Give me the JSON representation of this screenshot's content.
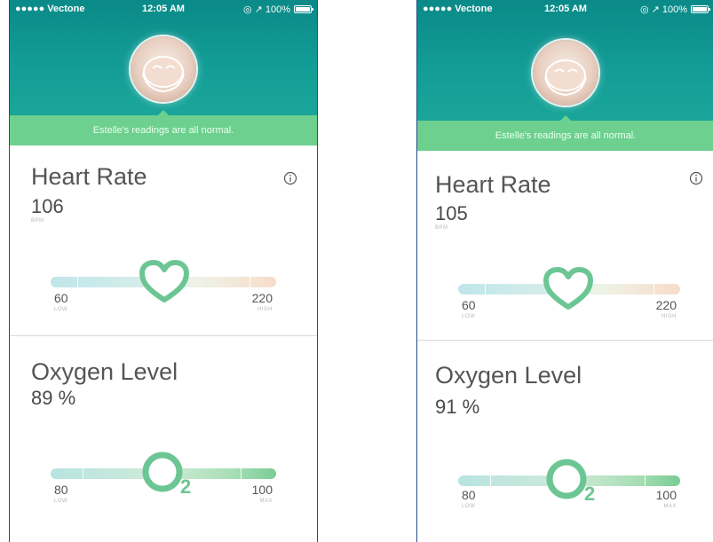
{
  "screens": [
    {
      "status": {
        "carrier": "●●●●● Vectone",
        "time": "12:05 AM",
        "right": "◎ ↗ 100%"
      },
      "banner": "Estelle's readings are all normal.",
      "heart_rate": {
        "title": "Heart Rate",
        "value": "106",
        "unit": "BPM",
        "min": "60",
        "min_label": "LOW",
        "max": "220",
        "max_label": "HIGH"
      },
      "oxygen": {
        "title": "Oxygen Level",
        "value": "89 %",
        "min": "80",
        "min_label": "LOW",
        "max": "100",
        "max_label": "MAX"
      }
    },
    {
      "status": {
        "carrier": "●●●●● Vectone",
        "time": "12:05 AM",
        "right": "◎ ↗ 100%"
      },
      "banner": "Estelle's readings are all normal.",
      "heart_rate": {
        "title": "Heart Rate",
        "value": "105",
        "unit": "BPM",
        "min": "60",
        "min_label": "LOW",
        "max": "220",
        "max_label": "HIGH"
      },
      "oxygen": {
        "title": "Oxygen Level",
        "value": "91 %",
        "min": "80",
        "min_label": "LOW",
        "max": "100",
        "max_label": "MAX"
      }
    }
  ],
  "icons": {
    "wifi": "wifi-icon",
    "info": "info-icon",
    "heart": "heart-icon",
    "oxygen": "o2-icon",
    "avatar": "baby-photo"
  },
  "colors": {
    "header_teal": "#0f9590",
    "banner_green": "#6dd08e",
    "marker_green": "#6cc694"
  }
}
